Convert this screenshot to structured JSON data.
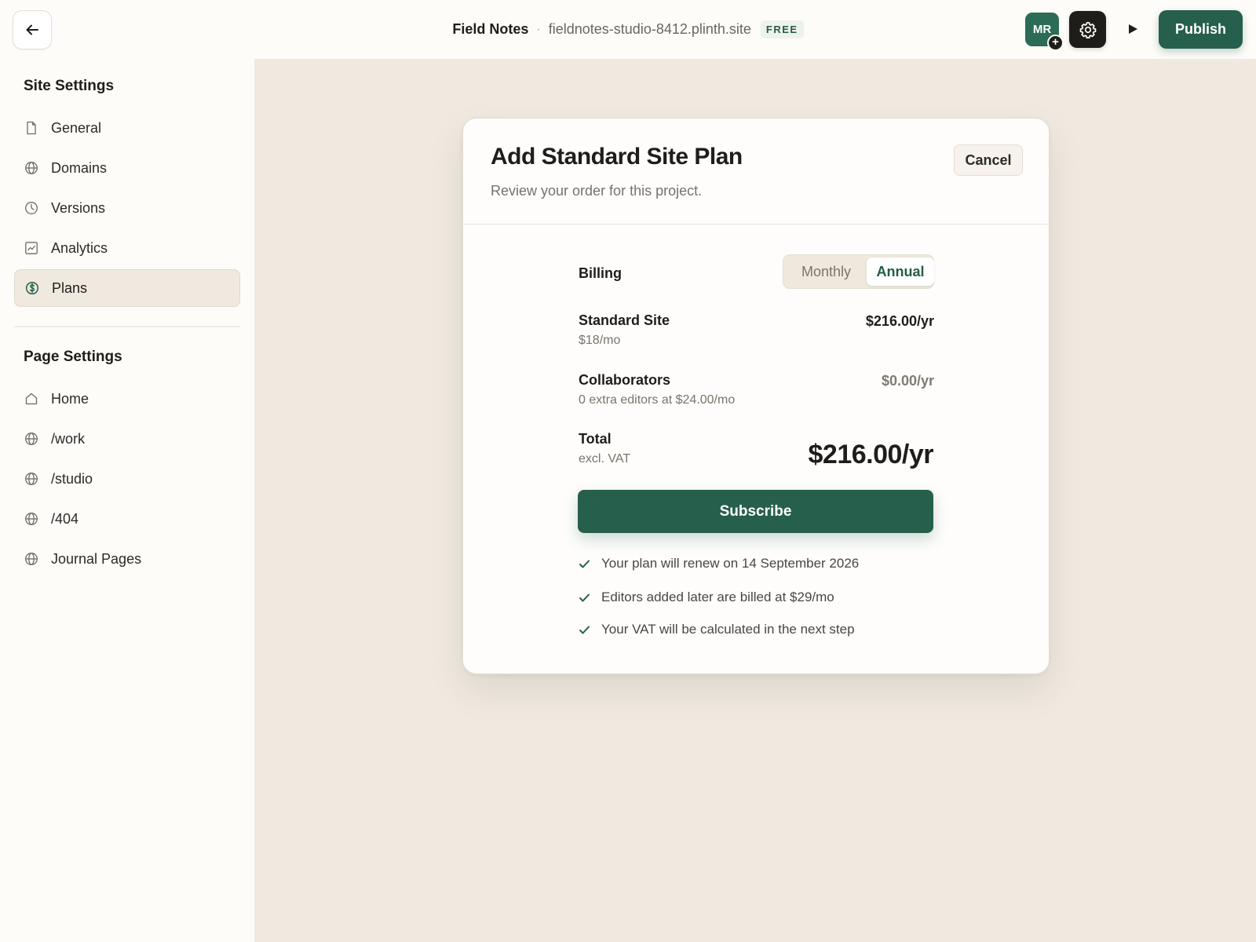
{
  "topbar": {
    "back_icon": "arrow-left-icon",
    "site_name": "Field Notes",
    "separator": "·",
    "site_url": "fieldnotes-studio-8412.plinth.site",
    "plan_badge": "FREE",
    "avatar_initials": "MR",
    "avatar_add": "+",
    "settings_icon": "gear-icon",
    "play_icon": "play-icon",
    "publish_label": "Publish"
  },
  "sidebar": {
    "site_settings_title": "Site Settings",
    "site_items": [
      {
        "label": "General",
        "icon": "file-icon"
      },
      {
        "label": "Domains",
        "icon": "globe-icon"
      },
      {
        "label": "Versions",
        "icon": "clock-icon"
      },
      {
        "label": "Analytics",
        "icon": "chart-icon"
      },
      {
        "label": "Plans",
        "icon": "dollar-circle-icon",
        "active": true
      }
    ],
    "page_settings_title": "Page Settings",
    "page_items": [
      {
        "label": "Home",
        "icon": "home-icon"
      },
      {
        "label": "/work",
        "icon": "globe-icon"
      },
      {
        "label": "/studio",
        "icon": "globe-icon"
      },
      {
        "label": "/404",
        "icon": "globe-icon"
      },
      {
        "label": "Journal Pages",
        "icon": "globe-icon"
      }
    ]
  },
  "modal": {
    "title": "Add Standard Site Plan",
    "subtitle": "Review your order for this project.",
    "cancel_label": "Cancel",
    "billing_label": "Billing",
    "billing_options": [
      "Monthly",
      "Annual"
    ],
    "billing_selected": "Annual",
    "standard": {
      "label": "Standard Site",
      "sub": "$18/mo",
      "price": "$216.00/yr"
    },
    "collaborators": {
      "label": "Collaborators",
      "sub": "0 extra editors at $24.00/mo",
      "price": "$0.00/yr"
    },
    "total": {
      "label": "Total",
      "sub": "excl. VAT",
      "price": "$216.00/yr"
    },
    "subscribe_label": "Subscribe",
    "notes": [
      "Your plan will renew on 14 September 2026",
      "Editors added later are billed at $29/mo",
      "Your VAT will be calculated in the next step"
    ]
  },
  "colors": {
    "accent": "#265f4c",
    "background": "#efe9e0",
    "sidebar_bg": "#fdfcf9",
    "active_item": "#efe9df"
  }
}
